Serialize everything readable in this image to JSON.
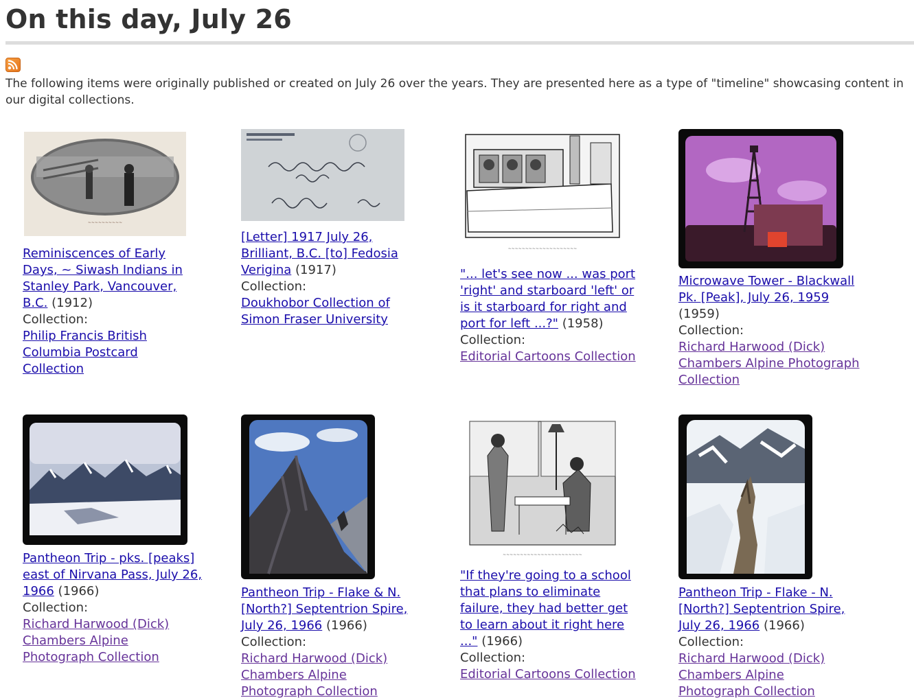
{
  "page": {
    "title": "On this day, July 26",
    "intro": "The following items were originally published or created on July 26 over the years. They are presented here as a type of \"timeline\" showcasing content in our digital collections.",
    "rss_icon": "rss-feed-icon",
    "colors": {
      "link": "#1a0dab",
      "visited_link": "#663399",
      "text": "#333333",
      "rule": "#dddddd",
      "rss": "#f08a2b"
    }
  },
  "collection_label": "Collection:",
  "items": [
    {
      "title": "Reminiscences of Early Days, ~ Siwash Indians in Stanley Park, Vancouver, B.C.",
      "year": "(1912)",
      "collection": "Philip Francis British Columbia Postcard Collection",
      "thumb": "postcard-photo"
    },
    {
      "title": "[Letter] 1917 July 26, Brilliant, B.C. [to] Fedosia Verigina",
      "year": "(1917)",
      "collection": "Doukhobor Collection of Simon Fraser University",
      "thumb": "envelope-photo"
    },
    {
      "title": "\"... let's see now ... was port 'right' and starboard 'left' or is it starboard for right and port for left ...?\"",
      "year": "(1958)",
      "collection": "Editorial Cartoons Collection",
      "thumb": "ship-cartoon"
    },
    {
      "title": "Microwave Tower - Blackwall Pk. [Peak], July 26, 1959",
      "year": "(1959)",
      "collection": "Richard Harwood (Dick) Chambers Alpine Photograph Collection",
      "thumb": "tower-slide"
    },
    {
      "title": "Pantheon Trip - pks. [peaks] east of Nirvana Pass, July 26, 1966",
      "year": "(1966)",
      "collection": "Richard Harwood (Dick) Chambers Alpine Photograph Collection",
      "thumb": "mountain-range-slide"
    },
    {
      "title": "Pantheon Trip - Flake & N. [North?] Septentrion Spire, July 26, 1966",
      "year": "(1966)",
      "collection": "Richard Harwood (Dick) Chambers Alpine Photograph Collection",
      "thumb": "rock-spire-slide"
    },
    {
      "title": "\"If they're going to a school that plans to eliminate failure, they had better get to learn about it right here ...\"",
      "year": "(1966)",
      "collection": "Editorial Cartoons Collection",
      "thumb": "kitchen-cartoon"
    },
    {
      "title": "Pantheon Trip - Flake - N. [North?] Septentrion Spire, July 26, 1966",
      "year": "(1966)",
      "collection": "Richard Harwood (Dick) Chambers Alpine Photograph Collection",
      "thumb": "snow-spire-slide"
    }
  ]
}
